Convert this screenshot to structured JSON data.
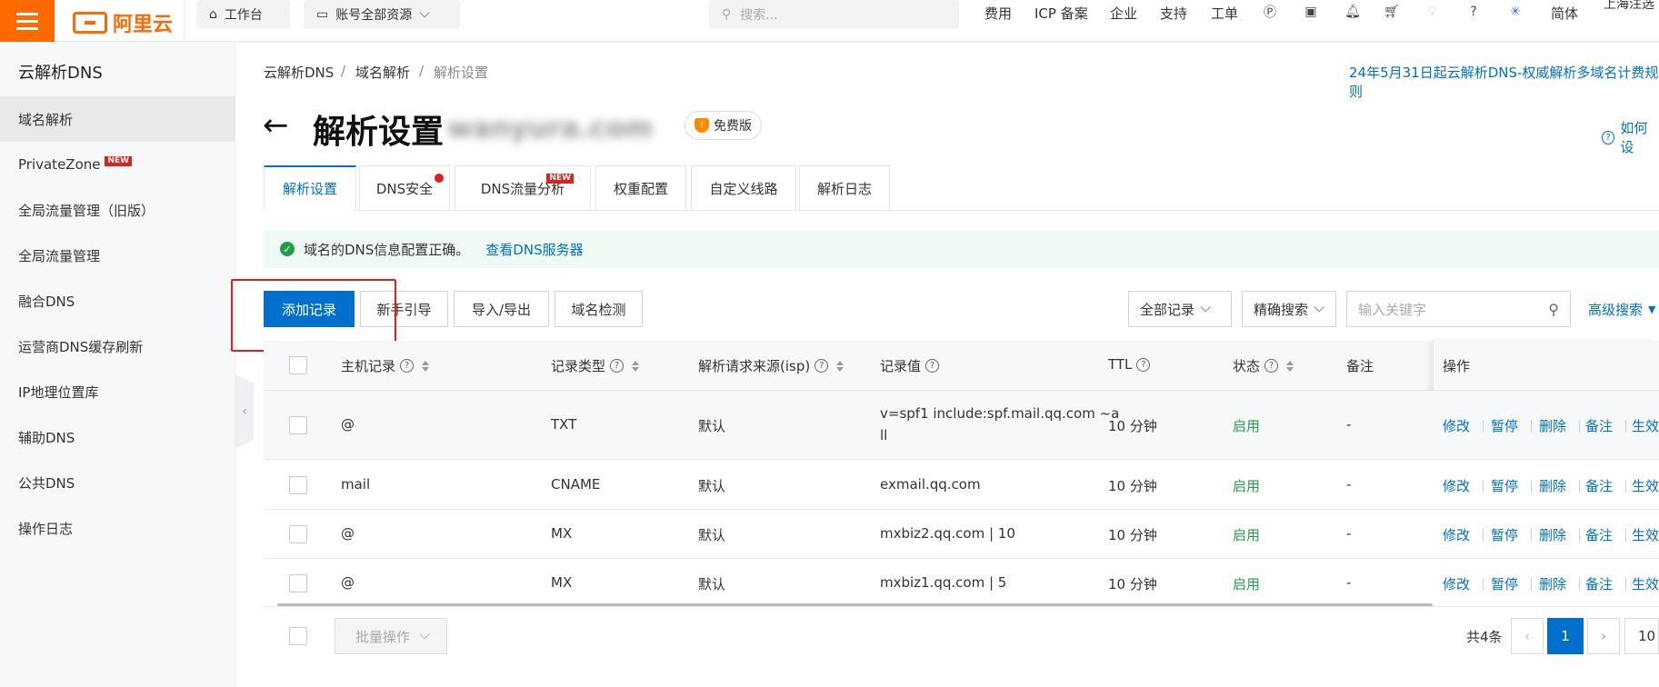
{
  "topbar": {
    "logo_text": "阿里云",
    "workbench": "工作台",
    "resources": "账号全部资源",
    "search_placeholder": "搜索...",
    "nav": [
      "费用",
      "ICP 备案",
      "企业",
      "支持",
      "工单"
    ],
    "lang": "简体",
    "account": "上海注选",
    "accent": "#ff6a00"
  },
  "sidebar": {
    "title": "云解析DNS",
    "items": [
      {
        "label": "域名解析",
        "active": true
      },
      {
        "label": "PrivateZone",
        "badge": "NEW"
      },
      {
        "label": "全局流量管理（旧版）"
      },
      {
        "label": "全局流量管理"
      },
      {
        "label": "融合DNS"
      },
      {
        "label": "运营商DNS缓存刷新"
      },
      {
        "label": "IP地理位置库"
      },
      {
        "label": "辅助DNS"
      },
      {
        "label": "公共DNS"
      },
      {
        "label": "操作日志"
      }
    ]
  },
  "breadcrumb": [
    "云解析DNS",
    "域名解析",
    "解析设置"
  ],
  "notice": "24年5月31日起云解析DNS-权威解析多域名计费规则",
  "page": {
    "title": "解析设置",
    "domain": "wanyura.com",
    "edition": "免费版",
    "help": "如何设"
  },
  "tabs": [
    {
      "label": "解析设置",
      "active": true
    },
    {
      "label": "DNS安全",
      "dot": true
    },
    {
      "label": "DNS流量分析",
      "badge": "NEW"
    },
    {
      "label": "权重配置"
    },
    {
      "label": "自定义线路"
    },
    {
      "label": "解析日志"
    }
  ],
  "alert": {
    "text": "域名的DNS信息配置正确。",
    "link": "查看DNS服务器"
  },
  "toolbar": {
    "add": "添加记录",
    "guide": "新手引导",
    "import_export": "导入/导出",
    "check": "域名检测",
    "filter": "全部记录",
    "match": "精确搜索",
    "keyword_placeholder": "输入关键字",
    "advanced": "高级搜索"
  },
  "table": {
    "headers": {
      "host": "主机记录",
      "type": "记录类型",
      "isp": "解析请求来源(isp)",
      "value": "记录值",
      "ttl": "TTL",
      "status": "状态",
      "remark": "备注",
      "ops": "操作"
    },
    "rows": [
      {
        "host": "@",
        "type": "TXT",
        "isp": "默认",
        "value1": "v=spf1 include:spf.mail.qq.com ~a",
        "value2": "ll",
        "ttl": "10 分钟",
        "status": "启用",
        "remark": "-"
      },
      {
        "host": "mail",
        "type": "CNAME",
        "isp": "默认",
        "value1": "exmail.qq.com",
        "value2": "",
        "ttl": "10 分钟",
        "status": "启用",
        "remark": "-"
      },
      {
        "host": "@",
        "type": "MX",
        "isp": "默认",
        "value1": "mxbiz2.qq.com | 10",
        "value2": "",
        "ttl": "10 分钟",
        "status": "启用",
        "remark": "-"
      },
      {
        "host": "@",
        "type": "MX",
        "isp": "默认",
        "value1": "mxbiz1.qq.com | 5",
        "value2": "",
        "ttl": "10 分钟",
        "status": "启用",
        "remark": "-"
      }
    ],
    "ops": [
      "修改",
      "暂停",
      "删除",
      "备注",
      "生效"
    ]
  },
  "footer": {
    "batch": "批量操作",
    "total": "共4条",
    "page": "1",
    "per_page": "10"
  }
}
